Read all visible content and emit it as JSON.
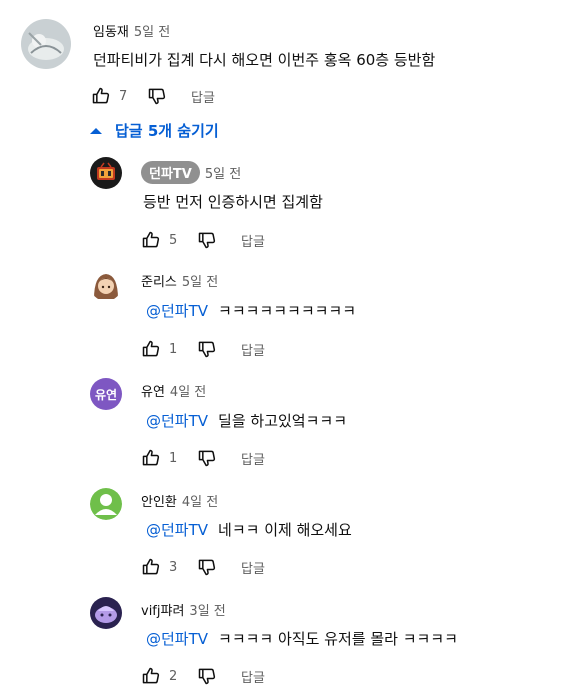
{
  "main": {
    "author": "임동재",
    "time": "5일 전",
    "text": "던파티비가 집계 다시 해오면 이번주 홍옥 60층 등반함",
    "likes": "7",
    "reply_label": "답글"
  },
  "replies_toggle": {
    "label": "답글 5개 숨기기"
  },
  "replies": [
    {
      "author": "던파TV",
      "time": "5일 전",
      "mention": "",
      "text": "등반 먼저 인증하시면 집계함",
      "likes": "5",
      "reply_label": "답글"
    },
    {
      "author": "준리스",
      "time": "5일 전",
      "mention": "@던파TV",
      "text": "ㅋㅋㅋㅋㅋㅋㅋㅋㅋㅋ",
      "likes": "1",
      "reply_label": "답글"
    },
    {
      "author": "유연",
      "time": "4일 전",
      "mention": "@던파TV",
      "text": "딜을 하고있엌ㅋㅋㅋ",
      "likes": "1",
      "reply_label": "답글",
      "avatar_text": "유연"
    },
    {
      "author": "안인환",
      "time": "4일 전",
      "mention": "@던파TV",
      "text": "네ㅋㅋ 이제 해오세요",
      "likes": "3",
      "reply_label": "답글"
    },
    {
      "author": "vifj퍄려",
      "time": "3일 전",
      "mention": "@던파TV",
      "text": "ㅋㅋㅋㅋ 아직도 유저를 몰라 ㅋㅋㅋㅋ",
      "likes": "2",
      "reply_label": "답글"
    }
  ],
  "colors": {
    "link": "#065fd4",
    "muted": "#606060",
    "chip_bg": "#909090",
    "yuyeon_avatar": "#7e57c2",
    "green_avatar": "#6fbf4a"
  }
}
